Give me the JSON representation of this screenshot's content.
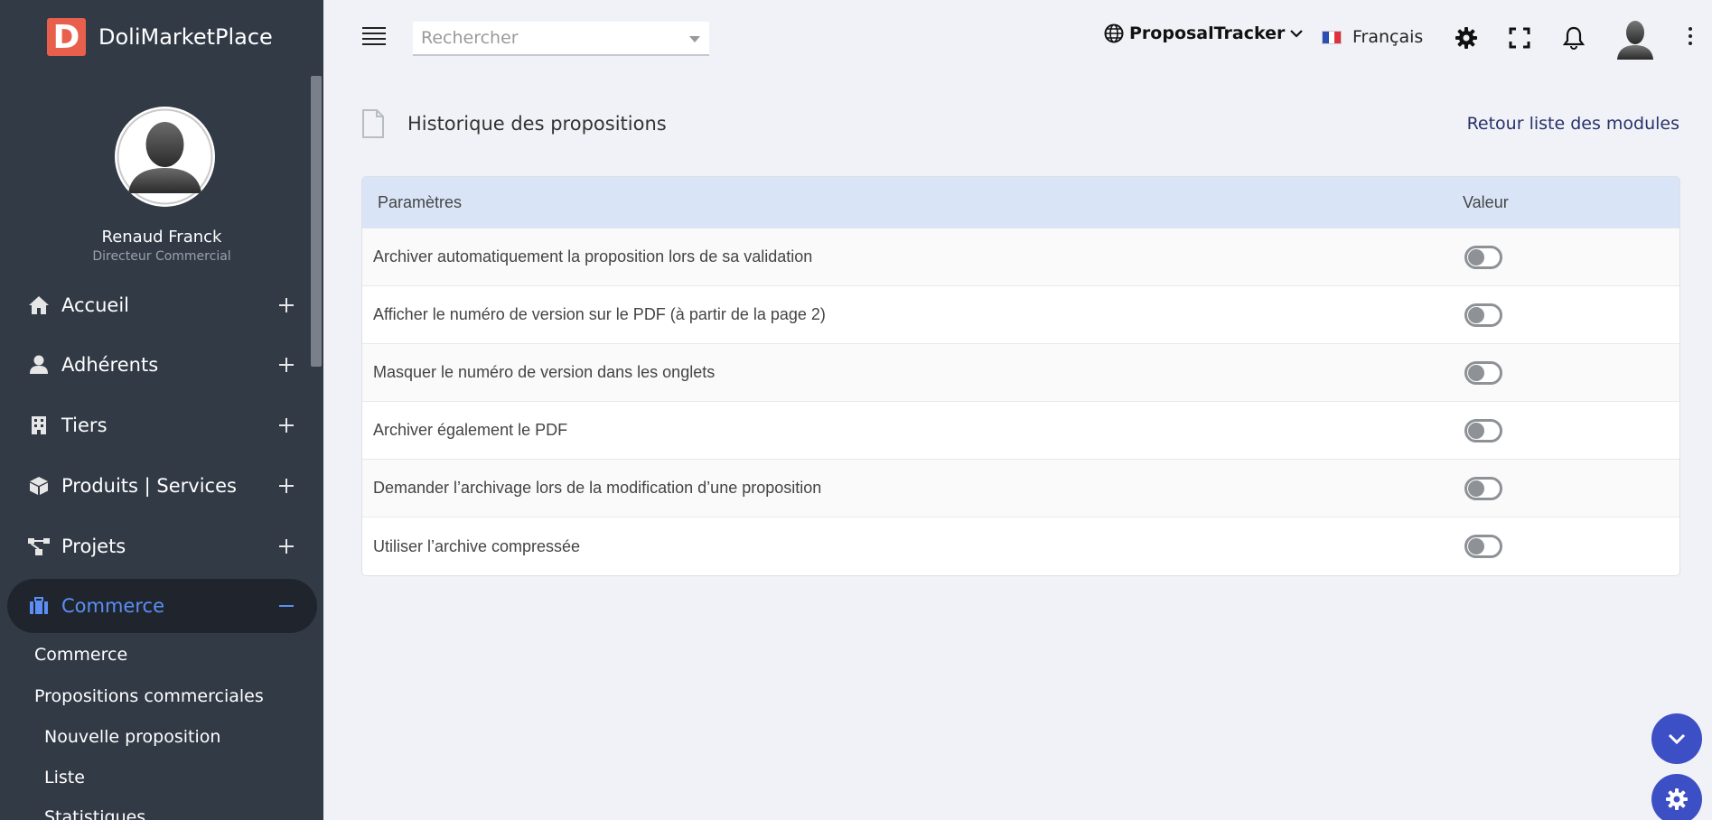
{
  "brand": {
    "logo_letter": "D",
    "name": "DoliMarketPlace"
  },
  "profile": {
    "name": "Renaud Franck",
    "role": "Directeur Commercial"
  },
  "nav": [
    {
      "label": "Accueil",
      "icon": "home-icon",
      "state": "collapsed"
    },
    {
      "label": "Adhérents",
      "icon": "user-icon",
      "state": "collapsed"
    },
    {
      "label": "Tiers",
      "icon": "building-icon",
      "state": "collapsed"
    },
    {
      "label": "Produits | Services",
      "icon": "cube-icon",
      "state": "collapsed"
    },
    {
      "label": "Projets",
      "icon": "sitemap-icon",
      "state": "collapsed"
    },
    {
      "label": "Commerce",
      "icon": "briefcase-icon",
      "state": "expanded"
    }
  ],
  "subnav": [
    "Commerce",
    "Propositions commerciales",
    "Nouvelle proposition",
    "Liste",
    "Statistiques"
  ],
  "topbar": {
    "search_placeholder": "Rechercher",
    "module": "ProposalTracker",
    "language": "Français"
  },
  "page": {
    "title": "Historique des propositions",
    "back_link": "Retour liste des modules"
  },
  "table": {
    "headers": [
      "Paramètres",
      "Valeur"
    ],
    "rows": [
      {
        "label": "Archiver automatiquement la proposition lors de sa validation",
        "value": "off"
      },
      {
        "label": "Afficher le numéro de version sur le PDF (à partir de la page 2)",
        "value": "off"
      },
      {
        "label": "Masquer le numéro de version dans les onglets",
        "value": "off"
      },
      {
        "label": "Archiver également le PDF",
        "value": "off"
      },
      {
        "label": "Demander l’archivage lors de la modification d’une proposition",
        "value": "off"
      },
      {
        "label": "Utiliser l’archive compressée",
        "value": "off"
      }
    ]
  },
  "colors": {
    "sidebar": "#323a46",
    "accent": "#5b8ff5",
    "header_row": "#d9e5f7",
    "fab": "#3d4fc4",
    "logo": "#e8604c"
  }
}
